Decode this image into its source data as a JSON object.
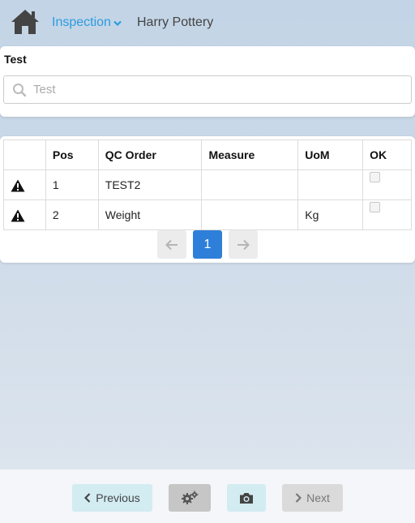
{
  "header": {
    "home_icon": "home-icon",
    "breadcrumb_inspection": "Inspection",
    "breadcrumb_project": "Harry Pottery"
  },
  "test_card": {
    "title": "Test",
    "search_placeholder": "Test",
    "search_value": ""
  },
  "table": {
    "headers": [
      "",
      "Pos",
      "QC Order",
      "Measure",
      "UoM",
      "OK"
    ],
    "rows": [
      {
        "icon": "warning-icon",
        "pos": "1",
        "qc_order": "TEST2",
        "measure": "",
        "uom": "",
        "ok": false
      },
      {
        "icon": "warning-icon",
        "pos": "2",
        "qc_order": "Weight",
        "measure": "",
        "uom": "Kg",
        "ok": false
      }
    ]
  },
  "pagination": {
    "current_page": "1",
    "prev_icon": "arrow-left-icon",
    "next_icon": "arrow-right-icon"
  },
  "footer": {
    "previous_label": "Previous",
    "next_label": "Next",
    "gear_icon": "gears-icon",
    "camera_icon": "camera-icon"
  },
  "colors": {
    "accent": "#2d9be0",
    "page_button_active": "#2e7fd9",
    "previous_button_bg": "#d2ecf2",
    "camera_button_bg": "#d2ecf2",
    "gear_button_bg": "#c6c6c6",
    "next_button_bg": "#dadada"
  }
}
